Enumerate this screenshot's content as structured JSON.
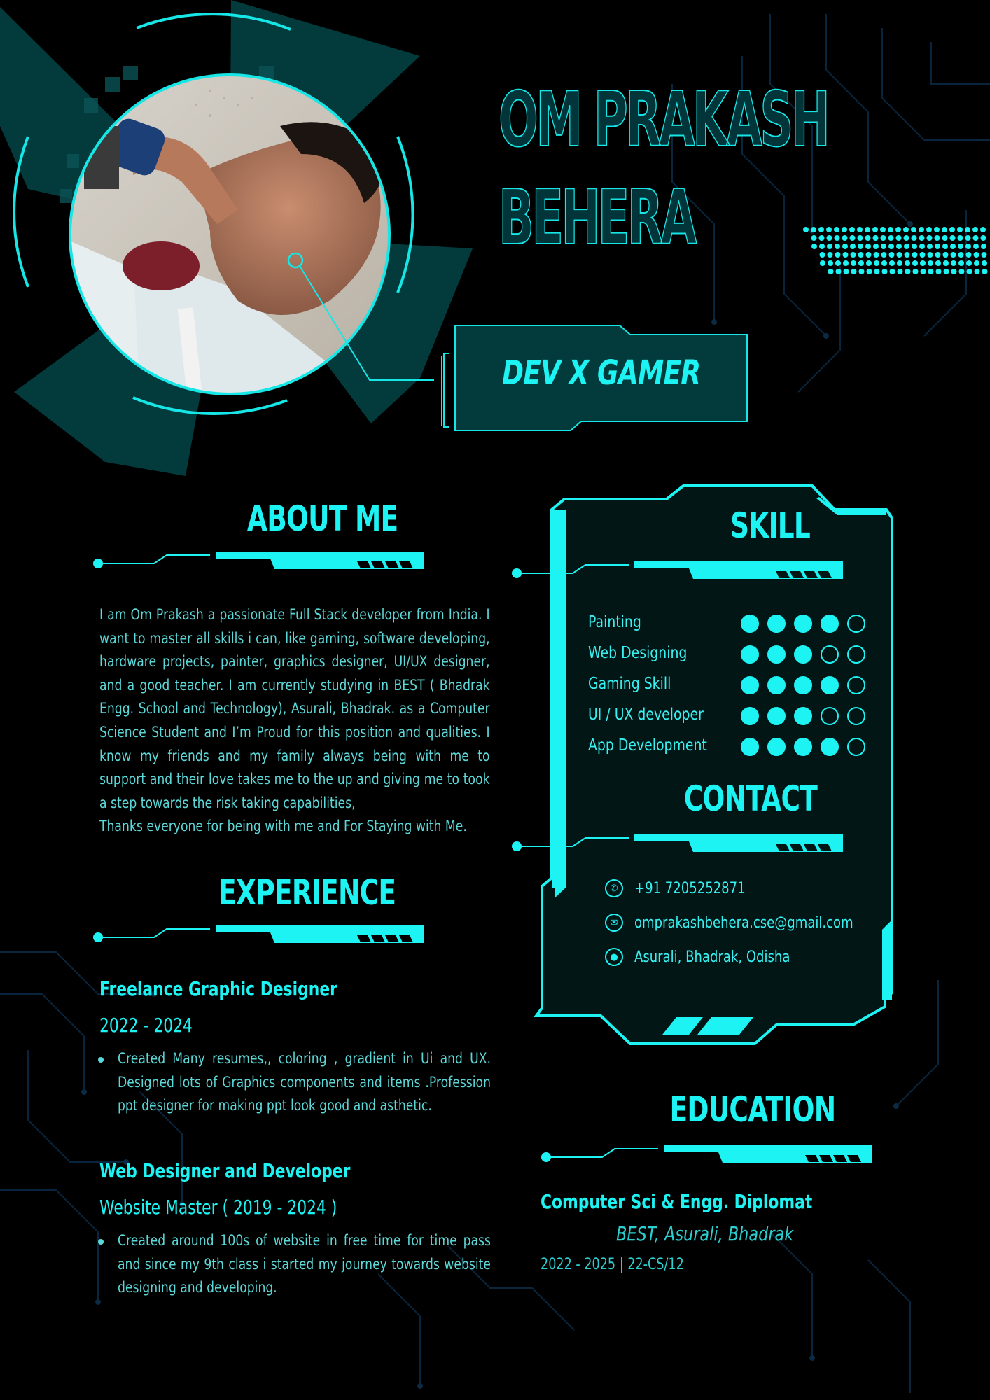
{
  "header": {
    "name_line1": "OM PRAKASH",
    "name_line2": "BEHERA",
    "tagline": "DEV X GAMER"
  },
  "about": {
    "title": "ABOUT ME",
    "text": "I am Om Prakash a passionate Full Stack developer from India. I want to master all skills i can, like gaming, software developing, hardware projects, painter, graphics designer, UI/UX designer, and a good teacher. I am currently studying in BEST ( Bhadrak Engg. School and Technology), Asurali, Bhadrak. as a Computer Science Student and I’m Proud for this position and qualities. I know my friends and my family always being with me to support and their love takes me to the up and giving me to took a step towards the risk taking capabilities,",
    "text_last": "Thanks everyone for being with me and For Staying with Me."
  },
  "experience": {
    "title": "EXPERIENCE",
    "jobs": [
      {
        "title": "Freelance Graphic Designer",
        "subtitle": "2022 - 2024",
        "desc": "Created Many resumes,, coloring , gradient in Ui and UX. Designed lots of Graphics components and items .Profession ppt designer for making ppt look good and asthetic."
      },
      {
        "title": "Web Designer and Developer",
        "subtitle": "Website Master ( 2019 - 2024 )",
        "desc": "Created around 100s of website in free time for time pass and since my 9th class i started my journey towards website designing and developing."
      }
    ]
  },
  "skill": {
    "title": "SKILL",
    "items": [
      {
        "label": "Painting",
        "level": 4,
        "max": 5
      },
      {
        "label": "Web Designing",
        "level": 3,
        "max": 5
      },
      {
        "label": "Gaming Skill",
        "level": 4,
        "max": 5
      },
      {
        "label": "UI / UX developer",
        "level": 3,
        "max": 5
      },
      {
        "label": "App Development",
        "level": 4,
        "max": 5
      }
    ]
  },
  "contact": {
    "title": "CONTACT",
    "phone": "+91 7205252871",
    "email": "omprakashbehera.cse@gmail.com",
    "address": "Asurali, Bhadrak, Odisha"
  },
  "education": {
    "title": "EDUCATION",
    "degree": "Computer Sci & Engg. Diplomat",
    "school": "BEST, Asurali, Bhadrak",
    "years": "2022 - 2025 |  22-CS/12"
  },
  "colors": {
    "accent": "#1ef3f3",
    "panel": "#021616",
    "teal_dark": "#033a3c",
    "background": "#000000"
  },
  "icons": [
    "phone-icon",
    "email-icon",
    "location-icon"
  ]
}
